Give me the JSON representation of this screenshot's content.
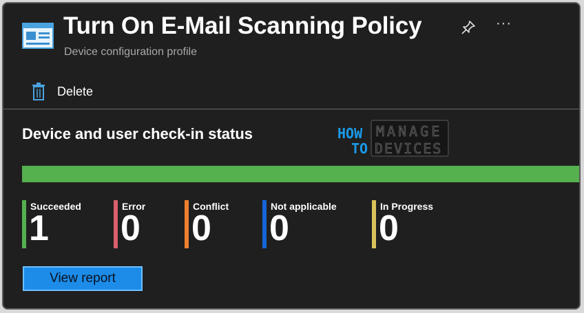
{
  "header": {
    "title": "Turn On E-Mail Scanning Policy",
    "subtitle": "Device configuration profile",
    "icons": [
      "policy-icon",
      "pin-icon",
      "more-icon"
    ],
    "more_label": "···"
  },
  "toolbar": {
    "delete_label": "Delete",
    "delete_icon": "trash-icon"
  },
  "status": {
    "section_title": "Device and user check-in status",
    "progress_fraction": 1.0,
    "progress_color": "#55b04e",
    "items": [
      {
        "label": "Succeeded",
        "value": "1",
        "color": "#55b04e"
      },
      {
        "label": "Error",
        "value": "0",
        "color": "#d9606b"
      },
      {
        "label": "Conflict",
        "value": "0",
        "color": "#f08030"
      },
      {
        "label": "Not applicable",
        "value": "0",
        "color": "#1565d8"
      },
      {
        "label": "In Progress",
        "value": "0",
        "color": "#d9c25a"
      }
    ]
  },
  "logo": {
    "line1": "HOW",
    "line2": "TO",
    "word1": "MANAGE",
    "word2": "DEVICES"
  },
  "actions": {
    "view_report_label": "View report"
  },
  "colors": {
    "background": "#1f1f1f",
    "accent": "#1c8ce8"
  }
}
